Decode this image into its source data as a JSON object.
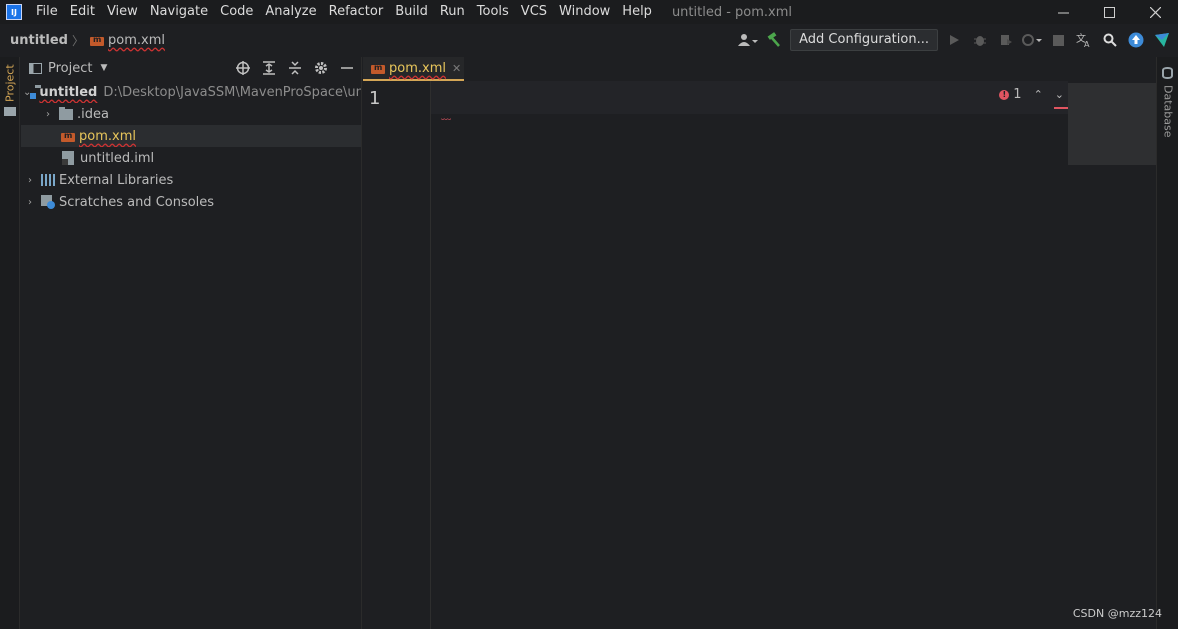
{
  "menu": {
    "items": [
      "File",
      "Edit",
      "View",
      "Navigate",
      "Code",
      "Analyze",
      "Refactor",
      "Build",
      "Run",
      "Tools",
      "VCS",
      "Window",
      "Help"
    ],
    "window_title": "untitled - pom.xml",
    "logo": "IJ"
  },
  "breadcrumb": {
    "root": "untitled",
    "file": "pom.xml"
  },
  "toolbar": {
    "add_configuration": "Add Configuration..."
  },
  "left_strip": {
    "project_tab": "Project"
  },
  "project_panel": {
    "title": "Project"
  },
  "tree": {
    "root_name": "untitled",
    "root_path": "D:\\Desktop\\JavaSSM\\MavenProSpace\\unti",
    "idea": ".idea",
    "pom": "pom.xml",
    "iml": "untitled.iml",
    "external_libraries": "External Libraries",
    "scratches": "Scratches and Consoles"
  },
  "editor": {
    "tab_label": "pom.xml",
    "line_number": "1",
    "error_count": "1"
  },
  "right_strip": {
    "database_tab": "Database"
  },
  "watermark": "CSDN @mzz124",
  "colors": {
    "background": "#1e1f22",
    "accent_tab": "#d4a656",
    "error": "#e05561",
    "maven": "#c35a2b",
    "selection": "#2b2d30"
  }
}
